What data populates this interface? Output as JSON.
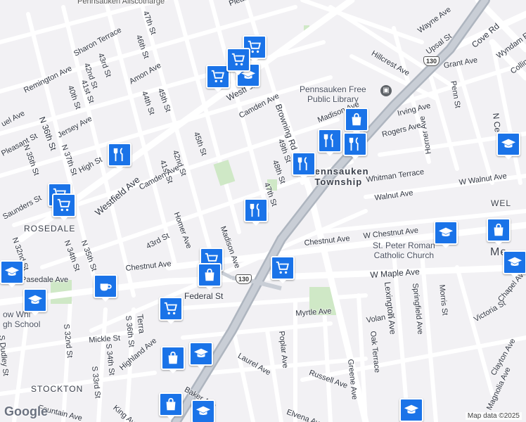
{
  "map": {
    "google_logo": "Google",
    "credit": "Map data ©2025",
    "areas": {
      "pennsauken_township": "Pennsauken\nTownship",
      "rosedale": "ROSEDALE",
      "stockton": "STOCKTON",
      "merchantville_partial": "Me",
      "wellwood_partial": "WEL"
    },
    "places": {
      "library": "Pennsauken Free\nPublic Library",
      "church": "St. Peter Roman\nCatholic Church",
      "school": "ow Whi\ngh School",
      "top_label": "Pennsauken Aliscotharge"
    },
    "highway_shield": "130",
    "streets": [
      "Sharon Terrace",
      "47th St",
      "46th St",
      "43rd St",
      "42nd St",
      "41st St",
      "40th St",
      "Remington Ave",
      "Amon Ave",
      "44th St",
      "45th St",
      "Camden Ave",
      "Westfield Ave",
      "Browning Rd",
      "49th St",
      "Madison Ave",
      "48th St",
      "47th St",
      "Whitman Terrace",
      "Walnut Ave",
      "W Walnut Ave",
      "Chestnut Ave",
      "W Chestnut Ave",
      "W Maple Ave",
      "Pleasant St",
      "Jersey Ave",
      "N 36th St",
      "N 37th St",
      "N 35th St",
      "High St",
      "Saunders St",
      "N 32nd St",
      "N 34th St",
      "N 35th St",
      "Myrtle Ave",
      "Federal St",
      "Laurel Ave",
      "Poplar Ave",
      "Volan St",
      "Oak Terrace",
      "Lexington Ave",
      "Springfield Ave",
      "Morris St",
      "Victoria St",
      "Chapel Ave",
      "Clayton Ave",
      "Magnolia Ave",
      "Greene Ave",
      "Russell Ave",
      "Elvena Ave",
      "Baker Ave",
      "Highland Ave",
      "Mickle St",
      "S 34th St",
      "S 33rd St",
      "S 32nd St",
      "S Dudley St",
      "S 36th St",
      "King Ave",
      "Fountain Ave",
      "Irving Ave",
      "Rogers Ave",
      "Horner Ave",
      "Penn St",
      "Grant Ave",
      "Hillcrest Ave",
      "Upsal St",
      "Wayne Ave",
      "Cove Rd",
      "Wyndam Rd",
      "Collins",
      "N Ce",
      "Homer Ave",
      "41st St",
      "42nd St",
      "43rd St",
      "Madison Ave",
      "Camden Ave",
      "Chestnut Ave",
      "Terra",
      "Pasedale Ave",
      "Pennsauken",
      "43rd St",
      "45th St",
      "Pleasant St",
      "Westfield",
      "uel Ave",
      "Clinton Ave",
      "Ave",
      "E"
    ]
  }
}
